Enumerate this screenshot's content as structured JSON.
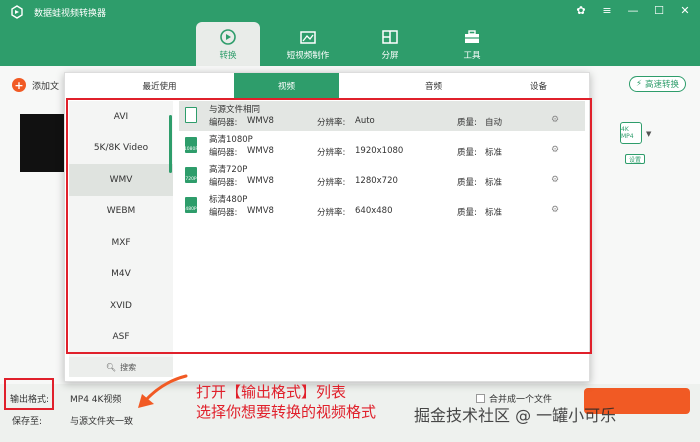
{
  "app": {
    "title": "数据蛙视频转换器"
  },
  "window_controls": [
    {
      "name": "skin-icon",
      "glyph": "✿"
    },
    {
      "name": "menu-icon",
      "glyph": "≡"
    },
    {
      "name": "minimize-icon",
      "glyph": "—"
    },
    {
      "name": "maximize-icon",
      "glyph": "☐"
    },
    {
      "name": "close-icon",
      "glyph": "✕"
    }
  ],
  "nav": {
    "tabs": [
      "转换",
      "短视频制作",
      "分屏",
      "工具"
    ],
    "active": "转换"
  },
  "main": {
    "add_file_label": "添加文",
    "fast_convert_label": "高速转换",
    "format_icon_label": "4K MP4",
    "settings_mini_label": "设置"
  },
  "bottom": {
    "output_format_label": "输出格式:",
    "output_format_value": "MP4 4K视频",
    "save_to_label": "保存至:",
    "save_to_value": "与源文件夹一致",
    "merge_label": "合并成一个文件"
  },
  "panel": {
    "tabs": [
      "最近使用",
      "视频",
      "音频",
      "设备"
    ],
    "active_tab": "视频",
    "formats": [
      "AVI",
      "5K/8K Video",
      "WMV",
      "WEBM",
      "MXF",
      "M4V",
      "XVID",
      "ASF"
    ],
    "selected_format": "WMV",
    "search_label": "搜索",
    "labels": {
      "encoder": "编码器:",
      "resolution": "分辨率:",
      "quality": "质量:"
    },
    "presets": [
      {
        "name": "与源文件相同",
        "encoder": "WMV8",
        "resolution": "Auto",
        "quality": "自动",
        "icon": ""
      },
      {
        "name": "高清1080P",
        "encoder": "WMV8",
        "resolution": "1920x1080",
        "quality": "标准",
        "icon": "1080P"
      },
      {
        "name": "高清720P",
        "encoder": "WMV8",
        "resolution": "1280x720",
        "quality": "标准",
        "icon": "720P"
      },
      {
        "name": "标清480P",
        "encoder": "WMV8",
        "resolution": "640x480",
        "quality": "标准",
        "icon": "480P"
      }
    ]
  },
  "annotation": {
    "line1": "打开【输出格式】列表",
    "line2": "选择你想要转换的视频格式"
  },
  "watermark": "掘金技术社区 @ 一罐小可乐",
  "colors": {
    "brand_green": "#2e9d6b",
    "accent_orange": "#f15a24",
    "highlight_red": "#e0202b"
  }
}
